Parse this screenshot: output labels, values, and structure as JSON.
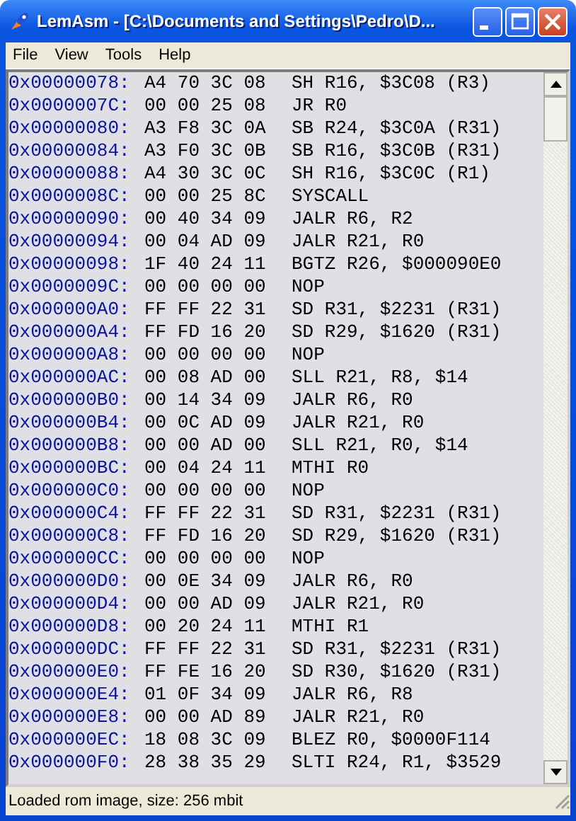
{
  "window": {
    "title": "LemAsm - [C:\\Documents and Settings\\Pedro\\D..."
  },
  "menu": [
    "File",
    "View",
    "Tools",
    "Help"
  ],
  "rows": [
    {
      "address": "0x00000078:",
      "bytes": "A4 70 3C 08",
      "instruction": "SH R16, $3C08 (R3)"
    },
    {
      "address": "0x0000007C:",
      "bytes": "00 00 25 08",
      "instruction": "JR R0"
    },
    {
      "address": "0x00000080:",
      "bytes": "A3 F8 3C 0A",
      "instruction": "SB R24, $3C0A (R31)"
    },
    {
      "address": "0x00000084:",
      "bytes": "A3 F0 3C 0B",
      "instruction": "SB R16, $3C0B (R31)"
    },
    {
      "address": "0x00000088:",
      "bytes": "A4 30 3C 0C",
      "instruction": "SH R16, $3C0C (R1)"
    },
    {
      "address": "0x0000008C:",
      "bytes": "00 00 25 8C",
      "instruction": "SYSCALL"
    },
    {
      "address": "0x00000090:",
      "bytes": "00 40 34 09",
      "instruction": "JALR R6, R2"
    },
    {
      "address": "0x00000094:",
      "bytes": "00 04 AD 09",
      "instruction": "JALR R21, R0"
    },
    {
      "address": "0x00000098:",
      "bytes": "1F 40 24 11",
      "instruction": "BGTZ R26, $000090E0"
    },
    {
      "address": "0x0000009C:",
      "bytes": "00 00 00 00",
      "instruction": "NOP"
    },
    {
      "address": "0x000000A0:",
      "bytes": "FF FF 22 31",
      "instruction": "SD R31, $2231 (R31)"
    },
    {
      "address": "0x000000A4:",
      "bytes": "FF FD 16 20",
      "instruction": "SD R29, $1620 (R31)"
    },
    {
      "address": "0x000000A8:",
      "bytes": "00 00 00 00",
      "instruction": "NOP"
    },
    {
      "address": "0x000000AC:",
      "bytes": "00 08 AD 00",
      "instruction": "SLL R21, R8, $14"
    },
    {
      "address": "0x000000B0:",
      "bytes": "00 14 34 09",
      "instruction": "JALR R6, R0"
    },
    {
      "address": "0x000000B4:",
      "bytes": "00 0C AD 09",
      "instruction": "JALR R21, R0"
    },
    {
      "address": "0x000000B8:",
      "bytes": "00 00 AD 00",
      "instruction": "SLL R21, R0, $14"
    },
    {
      "address": "0x000000BC:",
      "bytes": "00 04 24 11",
      "instruction": "MTHI R0"
    },
    {
      "address": "0x000000C0:",
      "bytes": "00 00 00 00",
      "instruction": "NOP"
    },
    {
      "address": "0x000000C4:",
      "bytes": "FF FF 22 31",
      "instruction": "SD R31, $2231 (R31)"
    },
    {
      "address": "0x000000C8:",
      "bytes": "FF FD 16 20",
      "instruction": "SD R29, $1620 (R31)"
    },
    {
      "address": "0x000000CC:",
      "bytes": "00 00 00 00",
      "instruction": "NOP"
    },
    {
      "address": "0x000000D0:",
      "bytes": "00 0E 34 09",
      "instruction": "JALR R6, R0"
    },
    {
      "address": "0x000000D4:",
      "bytes": "00 00 AD 09",
      "instruction": "JALR R21, R0"
    },
    {
      "address": "0x000000D8:",
      "bytes": "00 20 24 11",
      "instruction": "MTHI R1"
    },
    {
      "address": "0x000000DC:",
      "bytes": "FF FF 22 31",
      "instruction": "SD R31, $2231 (R31)"
    },
    {
      "address": "0x000000E0:",
      "bytes": "FF FE 16 20",
      "instruction": "SD R30, $1620 (R31)"
    },
    {
      "address": "0x000000E4:",
      "bytes": "01 0F 34 09",
      "instruction": "JALR R6, R8"
    },
    {
      "address": "0x000000E8:",
      "bytes": "00 00 AD 89",
      "instruction": "JALR R21, R0"
    },
    {
      "address": "0x000000EC:",
      "bytes": "18 08 3C 09",
      "instruction": "BLEZ R0, $0000F114"
    },
    {
      "address": "0x000000F0:",
      "bytes": "28 38 35 29",
      "instruction": "SLTI R24, R1, $3529"
    }
  ],
  "status_bar": "Loaded rom image, size: 256 mbit"
}
